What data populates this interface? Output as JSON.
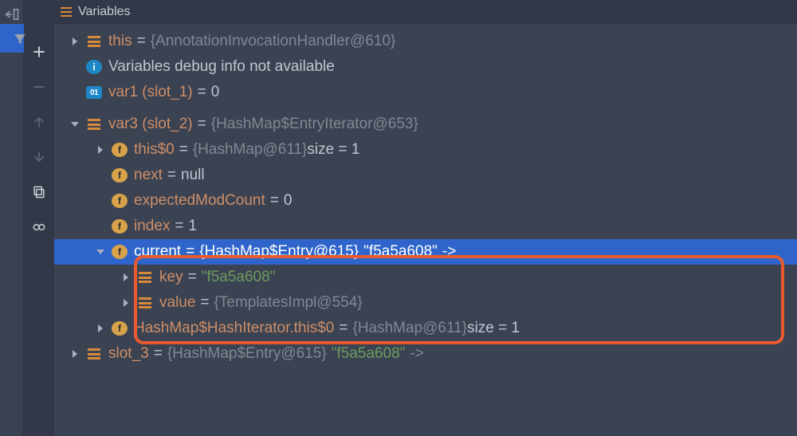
{
  "header": {
    "title": "Variables"
  },
  "rows": {
    "this": {
      "name": "this",
      "value": "{AnnotationInvocationHandler@610}"
    },
    "info": {
      "label": "Variables debug info not available"
    },
    "var1": {
      "name": "var1 (slot_1)",
      "value": "0"
    },
    "var3": {
      "name": "var3 (slot_2)",
      "value": "{HashMap$EntryIterator@653}"
    },
    "this0": {
      "name": "this$0",
      "value": "{HashMap@611}",
      "suffix": "  size = 1"
    },
    "next": {
      "name": "next",
      "value": "null"
    },
    "emc": {
      "name": "expectedModCount",
      "value": "0"
    },
    "index": {
      "name": "index",
      "value": "1"
    },
    "current": {
      "name": "current",
      "value": "{HashMap$Entry@615}",
      "strAfter": "\"f5a5a608\"",
      "tail": "->"
    },
    "key": {
      "name": "key",
      "value": "\"f5a5a608\""
    },
    "valueF": {
      "name": "value",
      "value": "{TemplatesImpl@554}"
    },
    "hhi": {
      "name": "HashMap$HashIterator.this$0",
      "value": "{HashMap@611}",
      "suffix": "  size = 1"
    },
    "slot3": {
      "name": "slot_3",
      "value": "{HashMap$Entry@615}",
      "strAfter": "\"f5a5a608\"",
      "tail": "->"
    }
  },
  "eq": "="
}
